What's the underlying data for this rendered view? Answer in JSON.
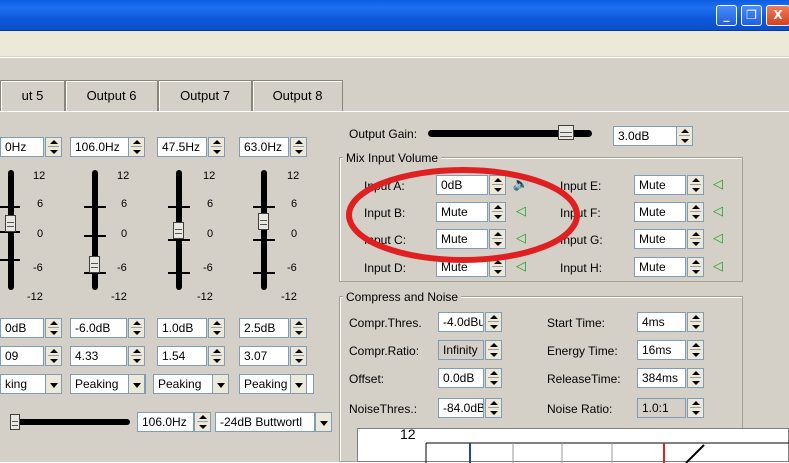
{
  "window": {
    "buttons": {
      "minimize": "_",
      "restore": "❐",
      "close": "X"
    }
  },
  "tabs": [
    "ut 5",
    "Output 6",
    "Output 7",
    "Output 8"
  ],
  "freq": [
    "0Hz",
    "106.0Hz",
    "47.5Hz",
    "63.0Hz"
  ],
  "scale_ticks": [
    "12",
    "6",
    "0",
    "-6",
    "-12"
  ],
  "gain": [
    "0dB",
    "-6.0dB",
    "1.0dB",
    "2.5dB"
  ],
  "q": [
    "09",
    "4.33",
    "1.54",
    "3.07"
  ],
  "filter_type": [
    "king",
    "Peaking",
    "Peaking",
    "Peaking"
  ],
  "bottom": {
    "freq": "106.0Hz",
    "filter": "-24dB Buttwortl"
  },
  "output_gain": {
    "label": "Output Gain:",
    "value": "3.0dB"
  },
  "mix_input": {
    "title": "Mix Input Volume",
    "left": [
      {
        "label": "Input A:",
        "value": "0dB"
      },
      {
        "label": "Input B:",
        "value": "Mute"
      },
      {
        "label": "Input C:",
        "value": "Mute"
      },
      {
        "label": "Input D:",
        "value": "Mute"
      }
    ],
    "right": [
      {
        "label": "Input E:",
        "value": "Mute"
      },
      {
        "label": "Input F:",
        "value": "Mute"
      },
      {
        "label": "Input G:",
        "value": "Mute"
      },
      {
        "label": "Input H:",
        "value": "Mute"
      }
    ]
  },
  "compress": {
    "title": "Compress and Noise",
    "threshold": {
      "label": "Compr.Thres.",
      "value": "-4.0dBu"
    },
    "ratio": {
      "label": "Compr.Ratio:",
      "value": "Infinity"
    },
    "offset": {
      "label": "Offset:",
      "value": "0.0dB"
    },
    "noise_thres": {
      "label": "NoiseThres.:",
      "value": "-84.0dB"
    },
    "start_time": {
      "label": "Start Time:",
      "value": "4ms"
    },
    "energy_time": {
      "label": "Energy Time:",
      "value": "16ms"
    },
    "release_time": {
      "label": "ReleaseTime:",
      "value": "384ms"
    },
    "noise_ratio": {
      "label": "Noise Ratio:",
      "value": "1.0:1"
    }
  },
  "graph": {
    "y_top_label": "12"
  },
  "colors": {
    "highlight_circle": "#e02020",
    "speaker_icon": "#1ea51e"
  }
}
